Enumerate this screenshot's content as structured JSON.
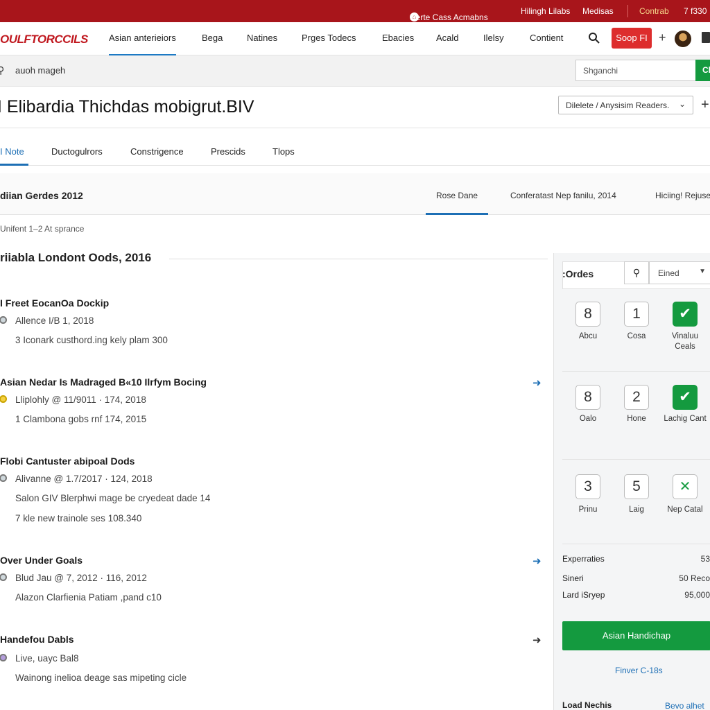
{
  "topbar": {
    "links": [
      "Herte Cass Acmabns",
      "Hilingh Lilabs",
      "Medisas"
    ],
    "contrab": "Contrab",
    "account": "7 f330"
  },
  "nav": {
    "logo": "OULFTORCCILS",
    "items": [
      "Asian anterieiors",
      "Bega",
      "Natines",
      "Prges Todecs",
      "Ebacies",
      "Acald",
      "Ilelsy",
      "Contient"
    ],
    "signup_label": "Soop FI"
  },
  "search": {
    "query": "auoh mageh",
    "placeholder": "Shganchi",
    "go_label": "Cl"
  },
  "page": {
    "title": "I Elibardia Thichdas mobigrut.BIV",
    "select_value": "Dilelete / Anysisim Readers."
  },
  "subtabs": [
    "I Note",
    "Ductogulrors",
    "Constrigence",
    "Prescids",
    "Tlops"
  ],
  "section": {
    "heading": "diian Gerdes 2012",
    "tabs": [
      "Rose Dane",
      "Conferatast Nep fanilu, 2014",
      "Hiciing! Rejuse"
    ],
    "meta": "Unifent 1–2 At sprance",
    "subheading": "riiabla Londont Oods, 2016"
  },
  "events": [
    {
      "name": "I Freet EocanOa Dockip",
      "lines": [
        "Allence I/B 1, 2018",
        "3 Iconark custhord.ing kely plam 300"
      ],
      "arrow": ""
    },
    {
      "name": "Asian Nedar Is Madraged B«10 Ilrfym Bocing",
      "lines": [
        "Lliplohly @ 11/9011 · 174, 2018",
        "1 Clambona gobs rnf 174, 2015"
      ],
      "arrow": "➜"
    },
    {
      "name": "Flobi Cantuster abipoal Dods",
      "lines": [
        "Alivanne @ 1.7/2017 · 124, 2018",
        "Salon GIV Blerphwi mage be cryedeat dade 14",
        "7 kle new trainole ses 108.340"
      ],
      "arrow": ""
    },
    {
      "name": "Over Under Goals",
      "lines": [
        "Blud Jau @ 7, 2012 · 116, 2012",
        "Alazon Clarfienia Patiam ,pand c10"
      ],
      "arrow": "➜"
    },
    {
      "name": "Handefou Dabls",
      "lines": [
        "Live, uayc Bal8",
        "Wainong inelioa deage sas mipeting cicle"
      ],
      "arrow": "➜"
    }
  ],
  "panel": {
    "title": ":Ordes",
    "select_value": "Eined",
    "tiles": [
      {
        "value": "8",
        "label": "Abcu"
      },
      {
        "value": "1",
        "label": "Cosa"
      },
      {
        "value": "",
        "label": "Vinaluu Ceals"
      },
      {
        "value": "8",
        "label": "Oalo"
      },
      {
        "value": "2",
        "label": "Hone"
      },
      {
        "value": "",
        "label": "Lachig Cant"
      },
      {
        "value": "3",
        "label": "Prinu"
      },
      {
        "value": "5",
        "label": "Laig"
      },
      {
        "value": "✕",
        "label": "Nep Catal"
      }
    ],
    "stats": [
      {
        "label": "Experraties",
        "value": "53"
      },
      {
        "label": "Sineri",
        "value": "50 Reco"
      },
      {
        "label": "Lard iSryep",
        "value": "95,000"
      }
    ],
    "button_label": "Asian Handichap",
    "link_label": "Finver C-18s",
    "footer_label": "Load Nechis",
    "footer_link": "Bevo alhet"
  },
  "colors": {
    "brand_red": "#a8151b",
    "accent_blue": "#1d6fb5",
    "action_green": "#149a3f"
  }
}
